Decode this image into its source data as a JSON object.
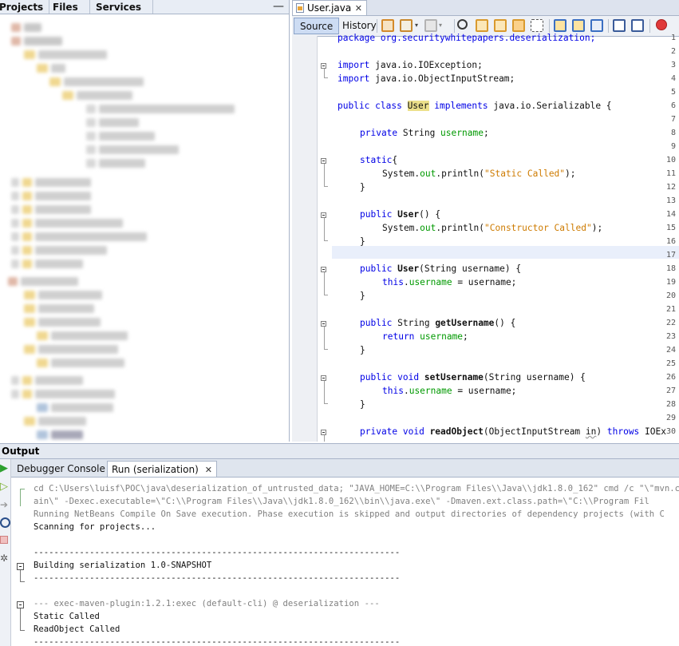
{
  "projects_panel": {
    "tabs": [
      "Projects",
      "Files",
      "Services"
    ],
    "minimize_label": "—"
  },
  "editor": {
    "file_tab": {
      "label": "User.java",
      "close": "✕"
    },
    "view_tabs": {
      "source": "Source",
      "history": "History"
    },
    "line_numbers": [
      "1",
      "2",
      "3",
      "4",
      "5",
      "6",
      "7",
      "8",
      "9",
      "10",
      "11",
      "12",
      "13",
      "14",
      "15",
      "16",
      "17",
      "18",
      "19",
      "20",
      "21",
      "22",
      "23",
      "24",
      "25",
      "26",
      "27",
      "28",
      "29",
      "30"
    ],
    "code": {
      "l1": "package org.securitywhitepapers.deserialization;",
      "l3_kw": "import",
      "l3": " java.io.IOException;",
      "l4_kw": "import",
      "l4": " java.io.ObjectInputStream;",
      "l6_kw1": "public class ",
      "l6_cls": "User",
      "l6_kw2": " implements",
      "l6": " java.io.Serializable {",
      "l8_kw": "private",
      "l8_t": " String ",
      "l8_f": "username",
      "l8_e": ";",
      "l10_kw": "static",
      "l10": "{",
      "l11_a": "System.",
      "l11_f": "out",
      "l11_b": ".println(",
      "l11_s": "\"Static Called\"",
      "l11_c": ");",
      "l12": "}",
      "l14_kw": "public ",
      "l14_m": "User",
      "l14": "() {",
      "l15_a": "System.",
      "l15_f": "out",
      "l15_b": ".println(",
      "l15_s": "\"Constructor Called\"",
      "l15_c": ");",
      "l16": "}",
      "l18_kw": "public ",
      "l18_m": "User",
      "l18": "(String username) {",
      "l19_kw": "this",
      "l19_a": ".",
      "l19_f": "username",
      "l19_b": " = username;",
      "l20": "}",
      "l22_kw": "public",
      "l22_t": " String ",
      "l22_m": "getUsername",
      "l22": "() {",
      "l23_kw": "return ",
      "l23_f": "username",
      "l23": ";",
      "l24": "}",
      "l26_kw": "public void ",
      "l26_m": "setUsername",
      "l26": "(String username) {",
      "l27_kw": "this",
      "l27_a": ".",
      "l27_f": "username",
      "l27_b": " = username;",
      "l28": "}",
      "l30_kw": "private void ",
      "l30_m": "readObject",
      "l30_a": "(ObjectInputStream ",
      "l30_p": "in",
      "l30_b": ") ",
      "l30_kw2": "throws",
      "l30_c": " IOEx"
    }
  },
  "output": {
    "title": "Output",
    "tabs": {
      "debugger": "Debugger Console",
      "run": "Run (serialization)",
      "close": "✕"
    },
    "lines": {
      "o1": "cd C:\\Users\\luisf\\POC\\java\\deserialization_of_untrusted_data; \"JAVA_HOME=C:\\\\Program Files\\\\Java\\\\jdk1.8.0_162\" cmd /c \"\\\"mvn.cmd -",
      "o2": "ain\\\" -Dexec.executable=\\\"C:\\\\Program Files\\\\Java\\\\jdk1.8.0_162\\\\bin\\\\java.exe\\\" -Dmaven.ext.class.path=\\\"C:\\\\Program Fil",
      "o3": "Running NetBeans Compile On Save execution. Phase execution is skipped and output directories of dependency projects (with C",
      "o4": "Scanning for projects...",
      "o6": "------------------------------------------------------------------------",
      "o7": "Building serialization 1.0-SNAPSHOT",
      "o8": "------------------------------------------------------------------------",
      "o10": "--- exec-maven-plugin:1.2.1:exec (default-cli) @ deserialization ---",
      "o11": "Static Called",
      "o12": "ReadObject Called",
      "o13": "------------------------------------------------------------------------"
    }
  },
  "colors": {
    "keyword": "#0000e6",
    "string": "#ce7b00",
    "field": "#009900",
    "highlight": "#ece08a"
  }
}
